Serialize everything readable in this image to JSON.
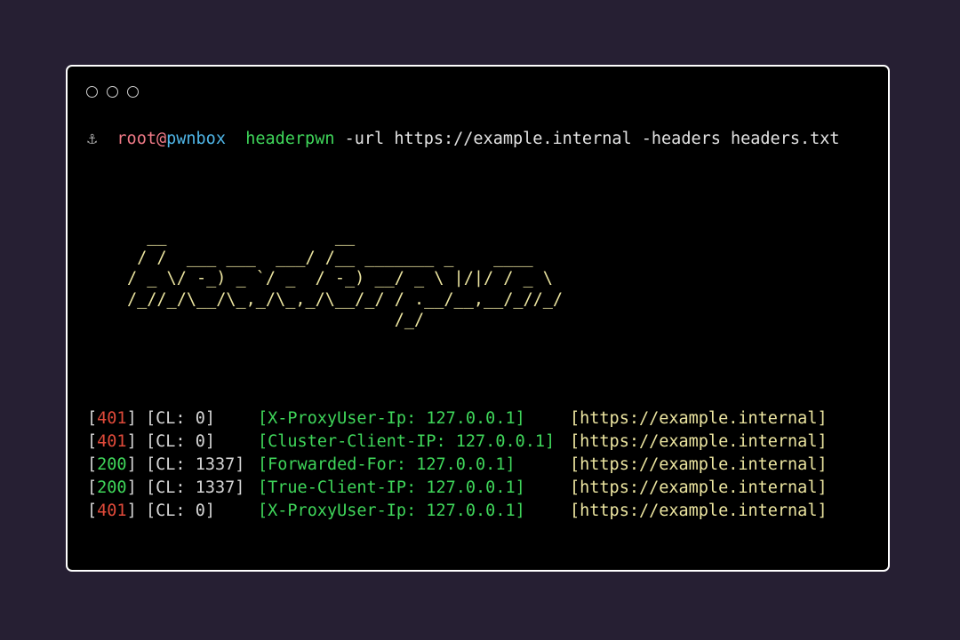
{
  "window": {
    "buttons": [
      "close",
      "minimize",
      "maximize"
    ]
  },
  "prompt": {
    "icon": "anchor-icon",
    "icon_glyph": "⚓",
    "user": "root",
    "at": "@",
    "host": "pwnbox",
    "command": "headerpwn",
    "arguments": "-url https://example.internal -headers headers.txt"
  },
  "banner": {
    "lines": [
      "  __                 __",
      " / /  ___ ___  ___/ /__ _______ _    ____",
      "/ _ \\/ -_) _ `/ _  / -_) __/ _ \\ |/|/ / _ \\",
      "/_//_/\\__/\\_,_/\\_,_/\\__/_/ / .__/__,__/_//_/",
      "                           /_/"
    ]
  },
  "results": [
    {
      "code": "401",
      "cl": "0",
      "header": "X-ProxyUser-Ip: 127.0.0.1",
      "url": "https://example.internal",
      "status_color": "#e04a3a"
    },
    {
      "code": "401",
      "cl": "0",
      "header": "Cluster-Client-IP: 127.0.0.1",
      "url": "https://example.internal",
      "status_color": "#e04a3a"
    },
    {
      "code": "200",
      "cl": "1337",
      "header": "Forwarded-For: 127.0.0.1",
      "url": "https://example.internal",
      "status_color": "#3fd65a"
    },
    {
      "code": "200",
      "cl": "1337",
      "header": "True-Client-IP: 127.0.0.1",
      "url": "https://example.internal",
      "status_color": "#3fd65a"
    },
    {
      "code": "401",
      "cl": "0",
      "header": "X-ProxyUser-Ip: 127.0.0.1",
      "url": "https://example.internal",
      "status_color": "#e04a3a"
    }
  ],
  "labels": {
    "cl_prefix": "CL: "
  },
  "colors": {
    "background": "#261f33",
    "terminal": "#000000",
    "banner": "#ece5a0",
    "header_green": "#3fd65a",
    "error_red": "#e04a3a",
    "user_pink": "#f07a87",
    "host_blue": "#4fb6e8"
  }
}
